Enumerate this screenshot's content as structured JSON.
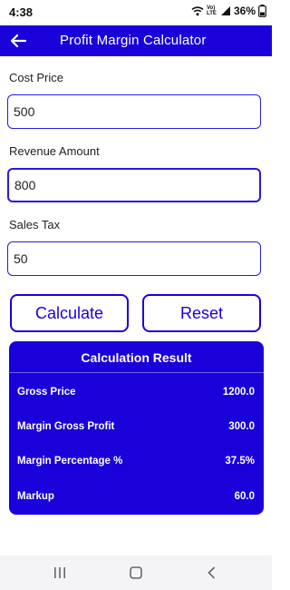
{
  "status_bar": {
    "time": "4:38",
    "battery": "36%",
    "network": "Vo) LTE"
  },
  "app_bar": {
    "title": "Profit Margin Calculator",
    "back_icon": "arrow-left-icon"
  },
  "form": {
    "cost_price": {
      "label": "Cost Price",
      "value": "500"
    },
    "revenue_amount": {
      "label": "Revenue Amount",
      "value": "800"
    },
    "sales_tax": {
      "label": "Sales Tax",
      "value": "50"
    }
  },
  "buttons": {
    "calculate": "Calculate",
    "reset": "Reset"
  },
  "result": {
    "title": "Calculation Result",
    "rows": [
      {
        "label": "Gross Price",
        "value": "1200.0"
      },
      {
        "label": "Margin Gross Profit",
        "value": "300.0"
      },
      {
        "label": "Margin Percentage %",
        "value": "37.5%"
      },
      {
        "label": "Markup",
        "value": "60.0"
      }
    ]
  },
  "nav": {
    "recents_icon": "recents-icon",
    "home_icon": "home-icon",
    "back_icon": "back-chevron-icon"
  },
  "colors": {
    "primary": "#1a00d9",
    "surface": "#ffffff",
    "nav_bar": "#f4f4f6"
  }
}
